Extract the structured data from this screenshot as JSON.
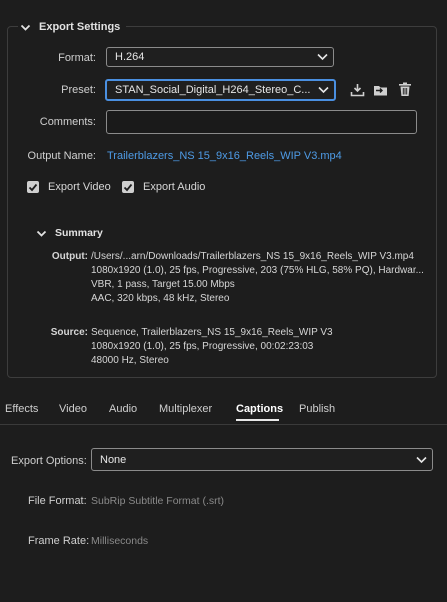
{
  "export_settings": {
    "title": "Export Settings",
    "format": {
      "label": "Format:",
      "value": "H.264"
    },
    "preset": {
      "label": "Preset:",
      "value": "STAN_Social_Digital_H264_Stereo_C..."
    },
    "comments": {
      "label": "Comments:",
      "value": ""
    },
    "output_name": {
      "label": "Output Name:",
      "value": "Trailerblazers_NS 15_9x16_Reels_WIP V3.mp4"
    },
    "export_video": {
      "label": "Export Video",
      "checked": true
    },
    "export_audio": {
      "label": "Export Audio",
      "checked": true
    },
    "icons": [
      "save-preset-icon",
      "import-preset-icon",
      "delete-preset-icon"
    ]
  },
  "summary": {
    "title": "Summary",
    "output": {
      "label": "Output:",
      "lines": [
        "/Users/...arn/Downloads/Trailerblazers_NS 15_9x16_Reels_WIP V3.mp4",
        "1080x1920 (1.0), 25 fps, Progressive, 203 (75% HLG, 58% PQ), Hardwar...",
        "VBR, 1 pass, Target 15.00 Mbps",
        "AAC, 320 kbps, 48 kHz, Stereo"
      ]
    },
    "source": {
      "label": "Source:",
      "lines": [
        "Sequence, Trailerblazers_NS 15_9x16_Reels_WIP V3",
        "1080x1920 (1.0), 25 fps, Progressive, 00:02:23:03",
        "48000 Hz, Stereo"
      ]
    }
  },
  "tabs": [
    {
      "label": "Effects",
      "active": false
    },
    {
      "label": "Video",
      "active": false
    },
    {
      "label": "Audio",
      "active": false
    },
    {
      "label": "Multiplexer",
      "active": false
    },
    {
      "label": "Captions",
      "active": true
    },
    {
      "label": "Publish",
      "active": false
    }
  ],
  "captions": {
    "export_options": {
      "label": "Export Options:",
      "value": "None"
    },
    "file_format": {
      "label": "File Format:",
      "value": "SubRip Subtitle Format (.srt)"
    },
    "frame_rate": {
      "label": "Frame Rate:",
      "value": "Milliseconds"
    }
  },
  "colors": {
    "background": "#1d1d1d",
    "accent_link": "#4e9be6",
    "focus_border": "#4a8fe0"
  }
}
